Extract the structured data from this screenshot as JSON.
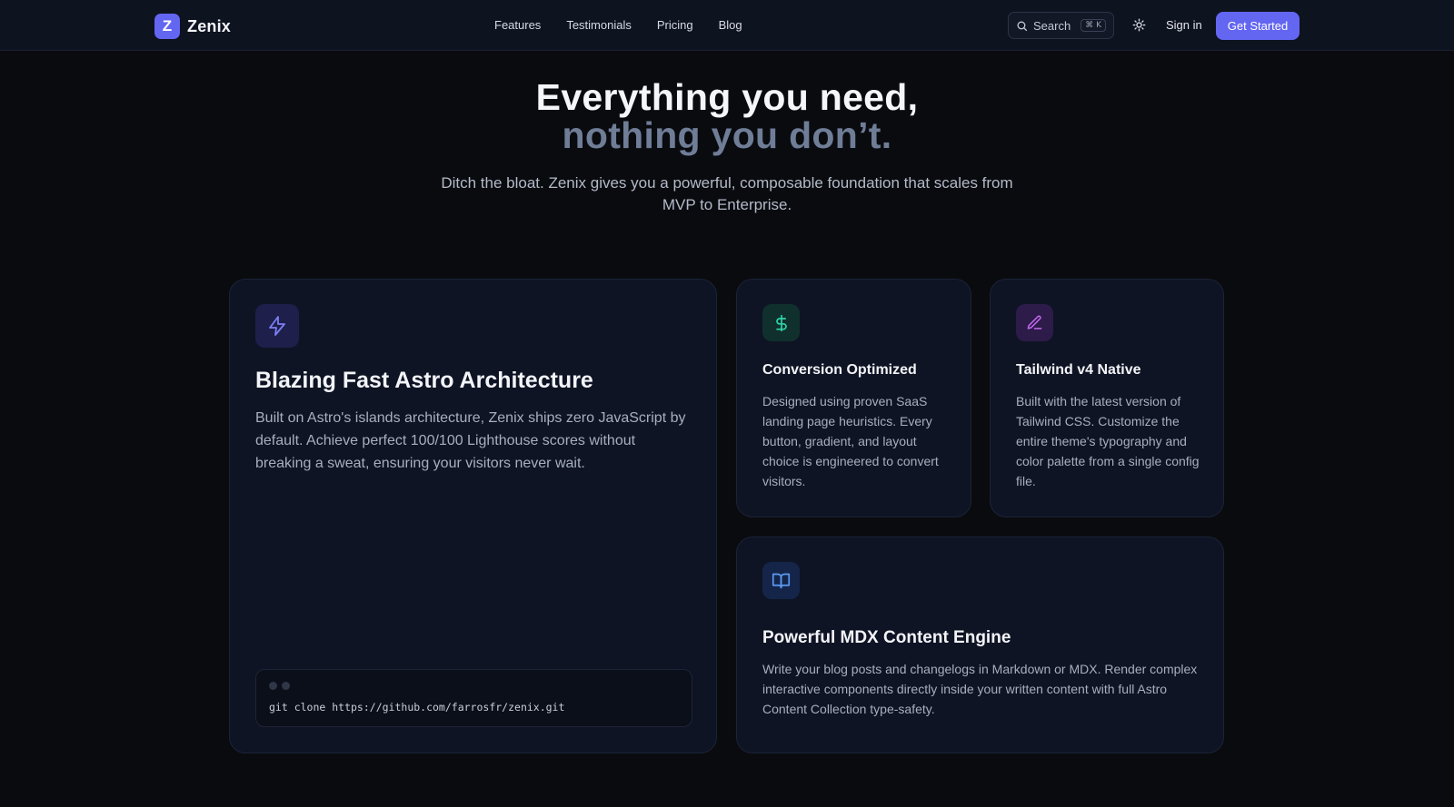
{
  "brand": {
    "mark": "Z",
    "name": "Zenix"
  },
  "nav": {
    "links": [
      "Features",
      "Testimonials",
      "Pricing",
      "Blog"
    ],
    "search_label": "Search",
    "search_shortcut": "⌘ K",
    "sign_in": "Sign in",
    "cta": "Get Started"
  },
  "hero": {
    "title_line1": "Everything you need,",
    "title_line2": "nothing you don’t.",
    "subtitle": "Ditch the bloat. Zenix gives you a powerful, composable foundation that scales from MVP to Enterprise."
  },
  "features": {
    "astro": {
      "icon": "lightning-icon",
      "title": "Blazing Fast Astro Architecture",
      "body": "Built on Astro's islands architecture, Zenix ships zero JavaScript by default. Achieve perfect 100/100 Lighthouse scores without breaking a sweat, ensuring your visitors never wait.",
      "command": "git clone https://github.com/farrosfr/zenix.git"
    },
    "conversion": {
      "icon": "dollar-icon",
      "title": "Conversion Optimized",
      "body": "Designed using proven SaaS landing page heuristics. Every button, gradient, and layout choice is engineered to convert visitors."
    },
    "tailwind": {
      "icon": "pencil-icon",
      "title": "Tailwind v4 Native",
      "body": "Built with the latest version of Tailwind CSS. Customize the entire theme's typography and color palette from a single config file."
    },
    "mdx": {
      "icon": "book-icon",
      "title": "Powerful MDX Content Engine",
      "body": "Write your blog posts and changelogs in Markdown or MDX. Render complex interactive components directly inside your written content with full Astro Content Collection type-safety."
    }
  },
  "colors": {
    "accent": "#6366f1",
    "background": "#0a0b0f",
    "card": "#0e1424",
    "muted_heading": "#6f7d97"
  }
}
